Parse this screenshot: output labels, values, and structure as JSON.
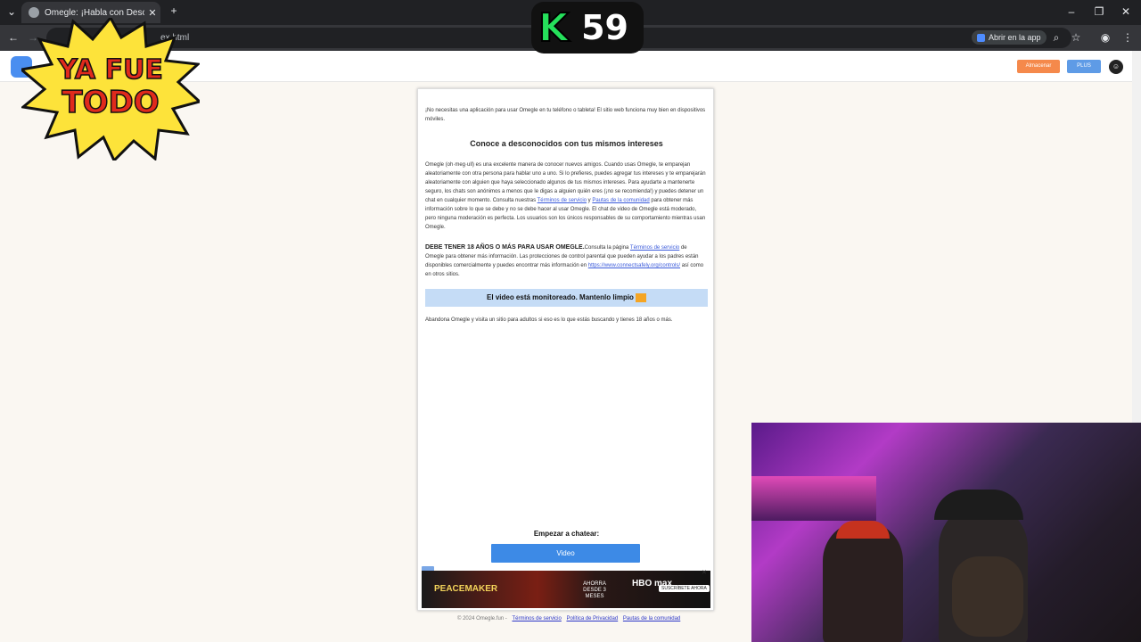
{
  "browser": {
    "tab_title": "Omegle: ¡Habla con Desconoc",
    "url_partial": "ex.html",
    "open_app": "Abrir en la app"
  },
  "site": {
    "save_label": "Almacenar",
    "plus_label": "PLUS"
  },
  "content": {
    "intro": "¡No necesitas una aplicación para usar Omegle en tu teléfono o tableta! El sitio web funciona muy bien en dispositivos móviles.",
    "heading": "Conoce a desconocidos con tus mismos intereses",
    "para2_a": "Omegle (oh·meg·ull) es una excelente manera de conocer nuevos amigos. Cuando usas Omegle, te emparejan aleatoriamente con otra persona para hablar uno a uno. Si lo prefieres, puedes agregar tus intereses y te emparejarán aleatoriamente con alguien que haya seleccionado algunos de tus mismos intereses. Para ayudarte a mantenerte seguro, los chats son anónimos a menos que le digas a alguien quién eres (¡no se recomienda!) y puedes detener un chat en cualquier momento. Consulta nuestras",
    "link_terms": "Términos de servicio",
    "and": "y",
    "link_guidelines": "Pautas de la comunidad",
    "para2_b": "para obtener más información sobre lo que se debe y no se debe hacer al usar Omegle. El chat de video de Omegle está moderado, pero ninguna moderación es perfecta. Los usuarios son los únicos responsables de su comportamiento mientras usan Omegle.",
    "age_bold": "DEBE TENER 18 AÑOS O MÁS PARA USAR OMEGLE.",
    "para3_a": "Consulta la página",
    "link_terms2": "Términos de servicio",
    "para3_b": "de Omegle para obtener más información. Las protecciones de control parental que pueden ayudar a los padres están disponibles comercialmente y puedes encontrar más información en",
    "link_connect": "https://www.connectsafely.org/controls/",
    "para3_c": "así como en otros sitios.",
    "banner": "El video está monitoreado. Mantenlo limpio",
    "adult": "Abandona Omegle y visita un sitio para adultos si eso es lo que estás buscando y tienes 18 años o más.",
    "start_label": "Empezar a chatear:",
    "video_button": "Video"
  },
  "ad": {
    "title": "PEACEMAKER",
    "promo": "AHORRA DESDE 3 MESES",
    "brand": "HBO max",
    "cta": "SUSCRÍBETE AHORA"
  },
  "footer": {
    "copyright": "© 2024 Omegle.fun -",
    "terms": "Términos de servicio",
    "privacy": "Política de Privacidad",
    "guidelines": "Pautas de la comunidad"
  },
  "overlay": {
    "k_letter": "K",
    "k_number": "59",
    "sticker_line1": "YA FUE",
    "sticker_line2": "TODO"
  }
}
